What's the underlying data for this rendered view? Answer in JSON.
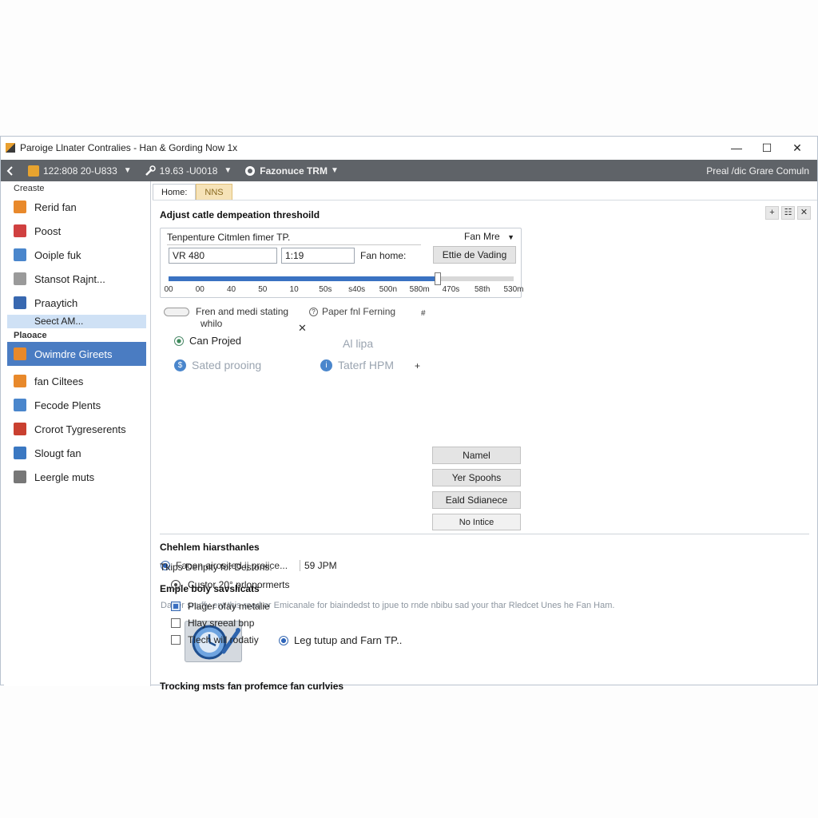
{
  "window": {
    "title": "Paroige Llnater Contralies - Han & Gording Now 1x",
    "controls": {
      "minimize": "—",
      "maximize": "☐",
      "close": "✕"
    }
  },
  "toolbar": {
    "back_icon": "back-arrow-icon",
    "item1": "122:808 20-U833",
    "item2": "19.63 -U0018",
    "item3": "Fazonuce TRM",
    "right": "Preal /dic Grare Comuln"
  },
  "sidebar": {
    "section1": "Creaste",
    "items_top": [
      {
        "label": "Rerid fan",
        "icon": "fan-orange-icon",
        "color": "#e8892b"
      },
      {
        "label": "Poost",
        "icon": "document-red-icon",
        "color": "#d04040"
      },
      {
        "label": "Ooiple fuk",
        "icon": "chart-blue-icon",
        "color": "#4a86cc"
      },
      {
        "label": "Stansot Rajnt...",
        "icon": "gear-gray-icon",
        "color": "#9a9a9a"
      },
      {
        "label": "Praaytich",
        "icon": "pointer-blue-icon",
        "color": "#3868b0"
      }
    ],
    "sub_selected": "Seect AM...",
    "section2": "Plaoace",
    "active_item": {
      "label": "Owimdre Gireets",
      "icon": "fan-orange-icon"
    },
    "items_bottom": [
      {
        "label": "fan Ciltees",
        "icon": "close-orange-icon",
        "color": "#e8892b"
      },
      {
        "label": "Fecode Plents",
        "icon": "chart-blue-icon",
        "color": "#4a86cc"
      },
      {
        "label": "Crorot Tygreserents",
        "icon": "alert-red-icon",
        "color": "#c94030"
      },
      {
        "label": "Slougt fan",
        "icon": "monitor-blue-icon",
        "color": "#3b78c2"
      },
      {
        "label": "Leergle muts",
        "icon": "disc-gray-icon",
        "color": "#777777"
      }
    ]
  },
  "tabs": [
    "Home:",
    "NNS"
  ],
  "mini_buttons": [
    "+",
    "☷",
    "✕"
  ],
  "threshold": {
    "heading": "Adjust catle dempeation threshoild",
    "panel_label": "Tenpenture Citmlen fimer TP.",
    "mode_label": "Fan Mre",
    "input1": "VR 480",
    "input2": "1:19",
    "fan_home_label": "Fan home:",
    "button": "Ettie de Vading",
    "slider_value_fraction": 0.78,
    "ticks": [
      "00",
      "00",
      "40",
      "50",
      "10",
      "50s",
      "s40s",
      "500n",
      "580m",
      "470s",
      "58th",
      "530m"
    ]
  },
  "options": {
    "toggle_label": "Fren and medi stating",
    "toggle_label2": "whilo",
    "close_x": "✕",
    "paper_label": "Paper fnl Ferning",
    "paper_hash": "#",
    "radio_label": "Can Projed",
    "faded1": "Al lipa",
    "faded2": "Sated prooing",
    "faded3": "Taterf HPM",
    "plus": "+",
    "buttons": [
      "Namel",
      "Yer Spoohs",
      "Eald Sdianece",
      "No Intice"
    ]
  },
  "thresholds": {
    "heading": "Chehlem hiarsthanles",
    "radio_label": "Faoen airosited ij proiice...",
    "rpm_value": "59 JPM"
  },
  "sample": {
    "heading": "Emple boly savslicats",
    "hint": "Datter snuffy ent this read or Emicanale for biaindedst to jpue to rnde nbibu sad your thar Rledcet Unes he Fan Ham.",
    "radio_label": "Leg tutup and Farn TP.."
  },
  "tracking": {
    "heading": "Trocking msts fan profemce fan curlvies",
    "subheading": "Tkips Denplty for Destons.",
    "radio_label": "Custor 20° prlopormerts",
    "checks": [
      {
        "label": "Plager ofay metalie",
        "checked": true
      },
      {
        "label": "Hlay sreeal bnp",
        "checked": false
      },
      {
        "label": "Tlech will rodatiy",
        "checked": false
      }
    ]
  }
}
